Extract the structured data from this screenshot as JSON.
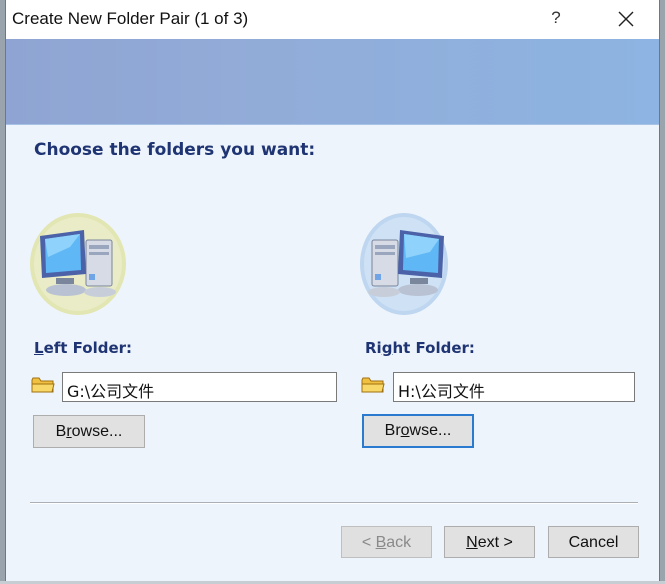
{
  "window": {
    "title": "Create New Folder Pair (1 of 3)",
    "help_label": "?",
    "close_icon": "close-icon"
  },
  "main": {
    "heading": "Choose the folders you want:",
    "left": {
      "label_mnemonic": "L",
      "label_rest": "eft Folder:",
      "path": "G:\\公司文件",
      "browse_pre": "B",
      "browse_mnemonic": "r",
      "browse_post": "owse...",
      "icon": "computer-icon"
    },
    "right": {
      "label_pre": "Ri",
      "label_mnemonic": "g",
      "label_rest": "ht Folder:",
      "path": "H:\\公司文件",
      "browse_pre": "Br",
      "browse_mnemonic": "o",
      "browse_post": "wse...",
      "icon": "computer-icon"
    }
  },
  "footer": {
    "back_pre": "< ",
    "back_mnemonic": "B",
    "back_post": "ack",
    "next_mnemonic": "N",
    "next_post": "ext >",
    "cancel_label": "Cancel"
  },
  "colors": {
    "heading": "#1f3473",
    "banner_start": "#8fa4d2",
    "banner_end": "#8db4e2",
    "focus_border": "#2a7bd0"
  }
}
